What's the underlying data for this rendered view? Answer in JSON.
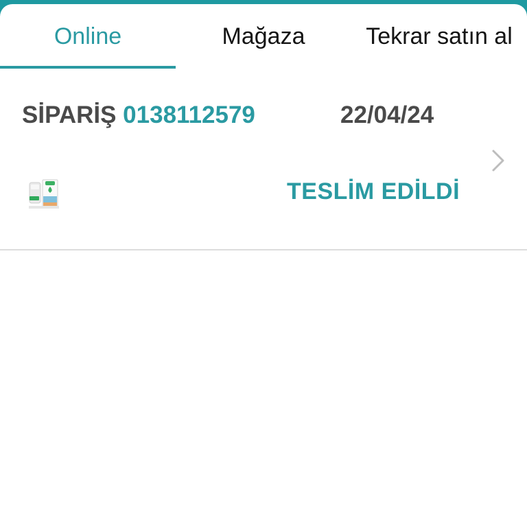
{
  "tabs": [
    {
      "label": "Online",
      "active": true
    },
    {
      "label": "Mağaza",
      "active": false
    },
    {
      "label": "Tekrar satın al",
      "active": false
    }
  ],
  "order": {
    "prefix": "SİPARİŞ",
    "number": "0138112579",
    "date": "22/04/24",
    "status": "TESLİM EDİLDİ",
    "thumbnail_icon": "product-thumbnail-icon",
    "chevron_icon": "chevron-right-icon"
  },
  "colors": {
    "accent": "#2a9aa2",
    "header_bar": "#1e9aa1",
    "text_dark": "#4a4a4a",
    "divider": "#dddddd"
  }
}
